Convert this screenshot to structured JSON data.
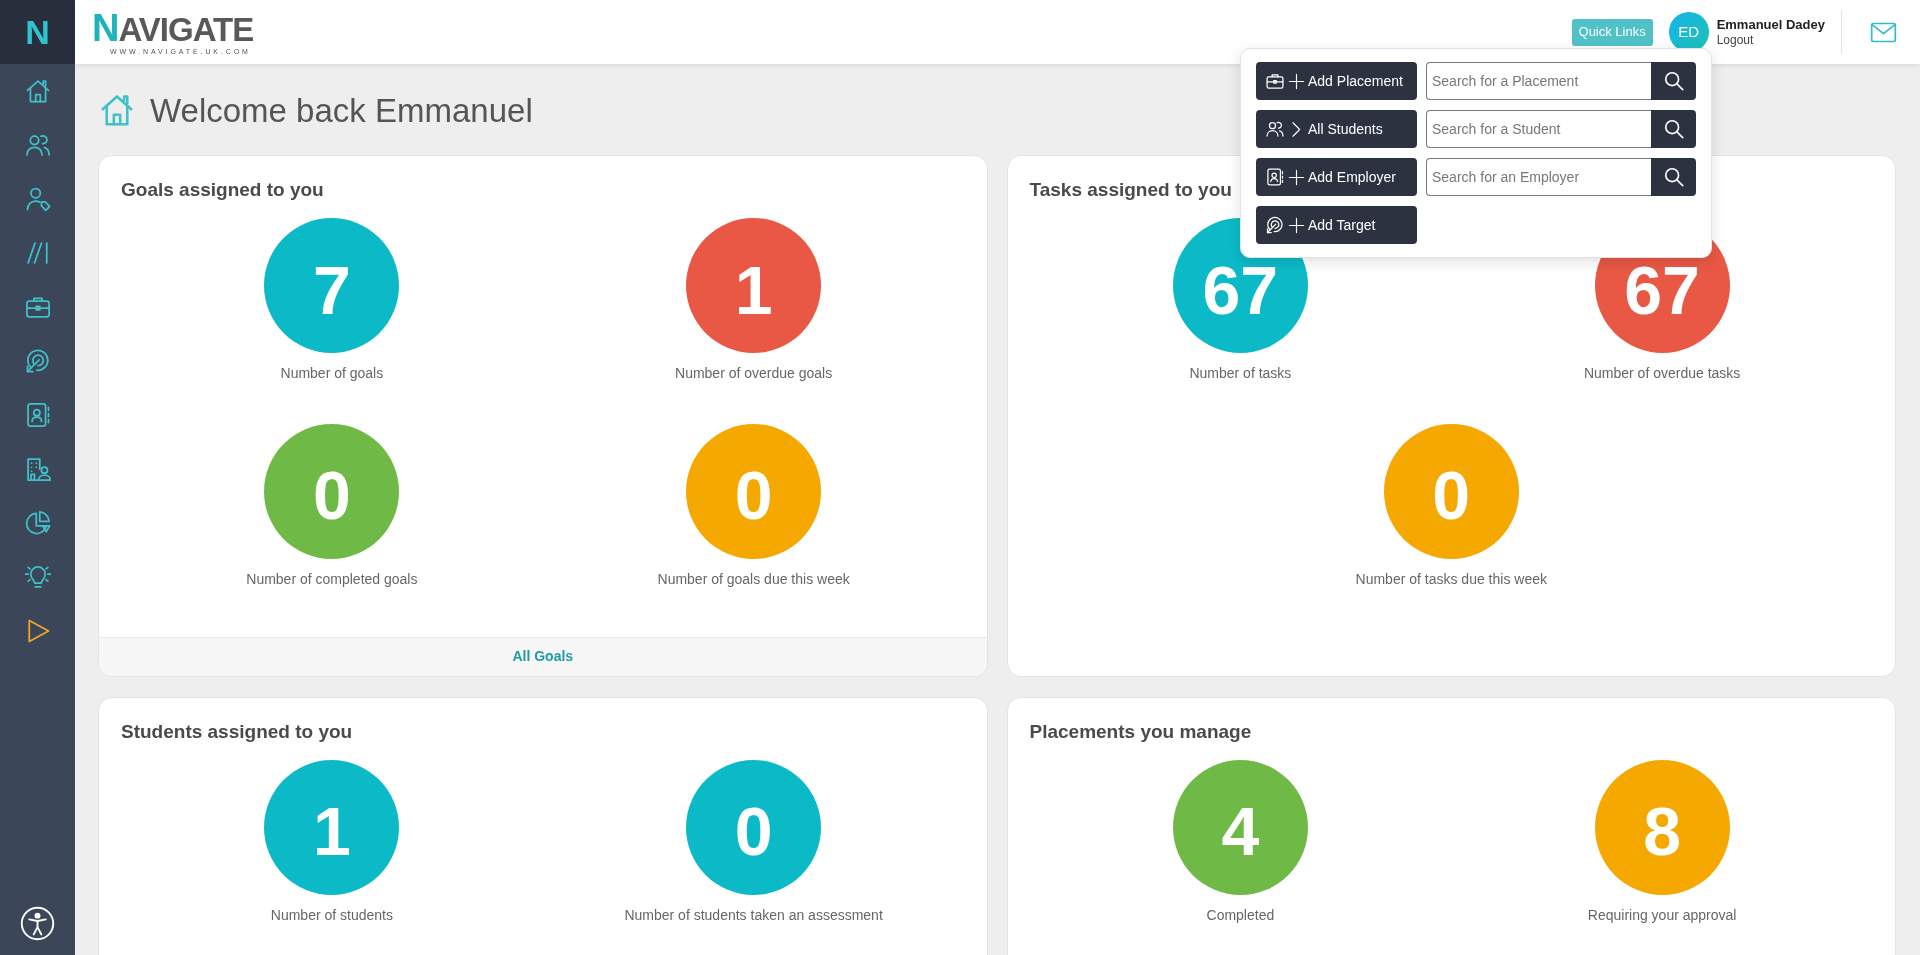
{
  "sidebar": {
    "logo": "N"
  },
  "header": {
    "logo": "NAVIGATE",
    "logo_tagline": "WWW.NAVIGATE.UK.COM",
    "quick_links_button": "Quick Links",
    "user": {
      "initials": "ED",
      "name": "Emmanuel Dadey",
      "logout": "Logout"
    }
  },
  "quick_links": [
    {
      "kind": "add",
      "label": "Add Placement",
      "search_placeholder": "Search for a Placement"
    },
    {
      "kind": "open",
      "label": "All Students",
      "search_placeholder": "Search for a Student"
    },
    {
      "kind": "add",
      "label": "Add Employer",
      "search_placeholder": "Search for an Employer"
    },
    {
      "kind": "add",
      "label": "Add Target"
    }
  ],
  "page_title": "Welcome back Emmanuel",
  "cards": [
    {
      "title": "Goals assigned to you",
      "stats": [
        {
          "value": "7",
          "label": "Number of goals",
          "color": "#0cbac7"
        },
        {
          "value": "1",
          "label": "Number of overdue goals",
          "color": "#e95845"
        },
        {
          "value": "0",
          "label": "Number of completed goals",
          "color": "#6fba47"
        },
        {
          "value": "0",
          "label": "Number of goals due this week",
          "color": "#f4a800"
        }
      ],
      "footer_link": "All Goals"
    },
    {
      "title": "Tasks assigned to you",
      "stats": [
        {
          "value": "67",
          "label": "Number of tasks",
          "color": "#0cbac7"
        },
        {
          "value": "67",
          "label": "Number of overdue tasks",
          "color": "#e95845"
        },
        {
          "value": "0",
          "label": "Number of tasks due this week",
          "color": "#f4a800"
        }
      ]
    },
    {
      "title": "Students assigned to you",
      "stats": [
        {
          "value": "1",
          "label": "Number of students",
          "color": "#0cbac7"
        },
        {
          "value": "0",
          "label": "Number of students taken an assessment",
          "color": "#0cbac7"
        }
      ]
    },
    {
      "title": "Placements you manage",
      "stats": [
        {
          "value": "4",
          "label": "Completed",
          "color": "#6fba47"
        },
        {
          "value": "8",
          "label": "Requiring your approval",
          "color": "#f4a800"
        }
      ]
    }
  ]
}
